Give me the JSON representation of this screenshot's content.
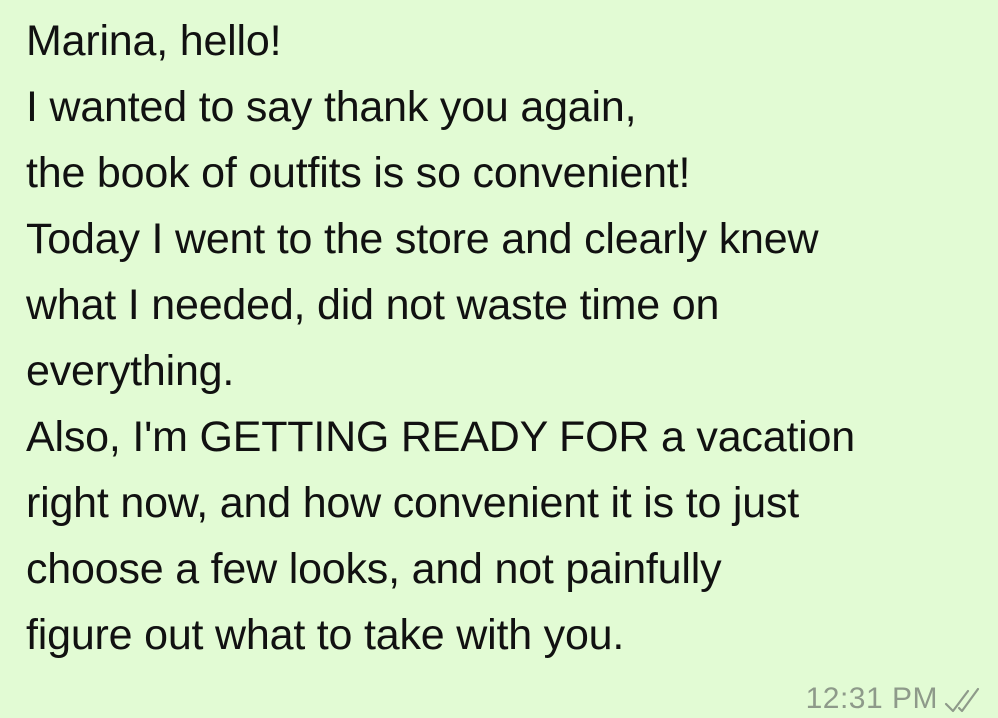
{
  "message": {
    "lines": [
      "Marina, hello!",
      "I wanted to say thank you again,",
      "the book of outfits is so convenient!",
      "Today I went to the store and clearly knew",
      "what I needed, did not waste time on",
      "everything.",
      "Also, I'm GETTING READY FOR a vacation",
      "right now, and how convenient it is to just",
      "choose a few looks, and not painfully",
      "figure out what to take with you."
    ],
    "time": "12:31 PM",
    "status_icon": "double-check-icon",
    "bubble_color": "#e2fbd4",
    "meta_color": "#8e9a8a"
  }
}
